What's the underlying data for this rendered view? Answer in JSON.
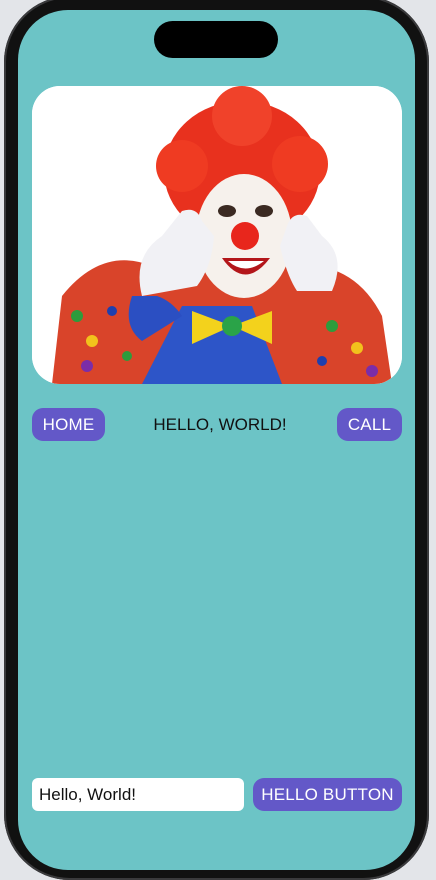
{
  "hero_image": {
    "icon": "clown-photo"
  },
  "nav": {
    "home_label": "HOME",
    "center_text": "HELLO, WORLD!",
    "call_label": "CALL"
  },
  "bottom": {
    "field_value": "Hello, World!",
    "button_label": "HELLO BUTTON"
  },
  "colors": {
    "screen_bg": "#6cc4c6",
    "button_bg": "#6358c8",
    "button_text": "#ffffff"
  }
}
